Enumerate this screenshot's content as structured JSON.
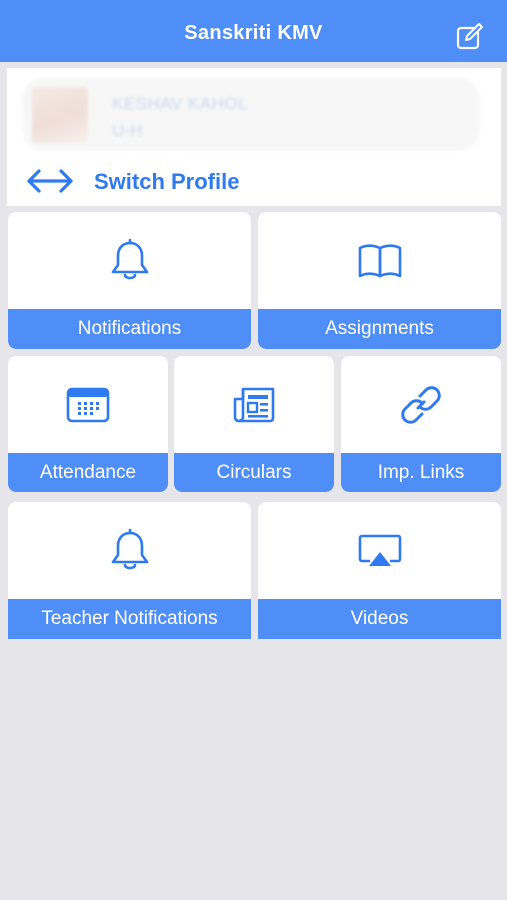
{
  "header": {
    "title": "Sanskriti KMV",
    "edit_icon": "compose-icon"
  },
  "profile": {
    "name": "KESHAV KAHOL",
    "class": "U-H",
    "switch_label": "Switch Profile",
    "switch_icon": "left-right-arrow-icon"
  },
  "menu": {
    "notifications": {
      "label": "Notifications",
      "icon": "bell-icon"
    },
    "assignments": {
      "label": "Assignments",
      "icon": "book-icon"
    },
    "attendance": {
      "label": "Attendance",
      "icon": "calendar-icon"
    },
    "circulars": {
      "label": "Circulars",
      "icon": "newspaper-icon"
    },
    "imp_links": {
      "label": "Imp. Links",
      "icon": "link-icon"
    },
    "teacher_notifications": {
      "label": "Teacher Notifications",
      "icon": "bell-icon"
    },
    "videos": {
      "label": "Videos",
      "icon": "airplay-icon"
    }
  },
  "colors": {
    "primary": "#4f8ef7",
    "accent_text": "#2f7af0",
    "background": "#e5e5ea"
  }
}
